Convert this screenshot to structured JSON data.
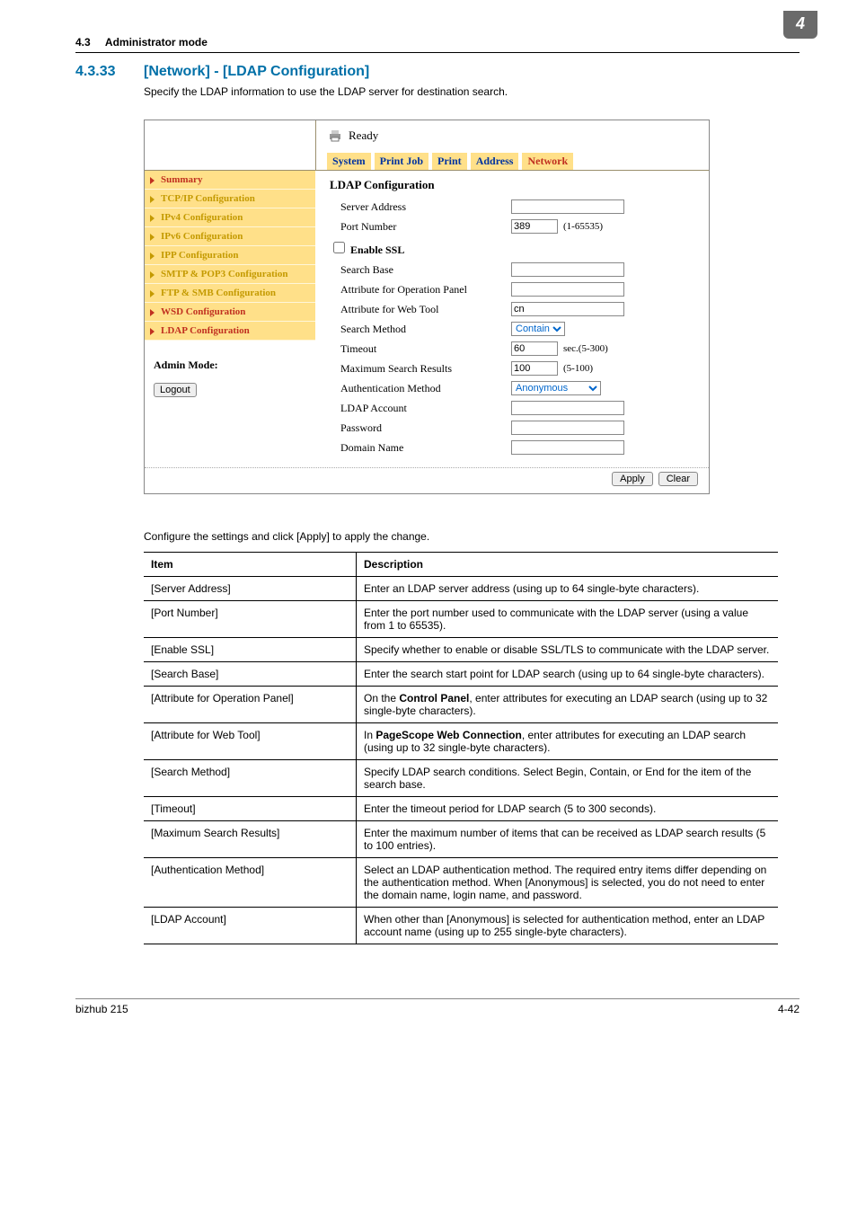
{
  "header": {
    "section_ref": "4.3",
    "section_ref_title": "Administrator mode",
    "badge": "4"
  },
  "section": {
    "num": "4.3.33",
    "title": "[Network] - [LDAP Configuration]"
  },
  "intro": "Specify the LDAP information to use the LDAP server for destination search.",
  "screenshot": {
    "ready": "Ready",
    "tabs": {
      "system": "System",
      "printjob": "Print Job",
      "print": "Print",
      "address": "Address",
      "network": "Network"
    },
    "side": {
      "summary": "Summary",
      "tcpip": "TCP/IP Configuration",
      "ipv4": "IPv4 Configuration",
      "ipv6": "IPv6 Configuration",
      "ipp": "IPP Configuration",
      "smtp": "SMTP & POP3 Configuration",
      "ftp": "FTP & SMB Configuration",
      "wsd": "WSD Configuration",
      "ldap": "LDAP Configuration"
    },
    "admin_mode": "Admin Mode:",
    "logout": "Logout",
    "form": {
      "title": "LDAP Configuration",
      "server_address": "Server Address",
      "port_number": "Port Number",
      "port_value": "389",
      "port_hint": "(1-65535)",
      "enable_ssl": "Enable SSL",
      "search_base": "Search Base",
      "attr_panel": "Attribute for Operation Panel",
      "attr_web": "Attribute for Web Tool",
      "attr_web_value": "cn",
      "search_method": "Search Method",
      "search_method_value": "Contain",
      "timeout": "Timeout",
      "timeout_value": "60",
      "timeout_hint": "sec.(5-300)",
      "max_results": "Maximum Search Results",
      "max_results_value": "100",
      "max_results_hint": "(5-100)",
      "auth_method": "Authentication Method",
      "auth_method_value": "Anonymous",
      "ldap_account": "LDAP Account",
      "password": "Password",
      "domain": "Domain Name",
      "apply": "Apply",
      "clear": "Clear"
    }
  },
  "config_text": "Configure the settings and click [Apply] to apply the change.",
  "table": {
    "head_item": "Item",
    "head_desc": "Description",
    "rows": [
      {
        "item": "[Server Address]",
        "desc": "Enter an LDAP server address (using up to 64 single-byte characters)."
      },
      {
        "item": "[Port Number]",
        "desc": "Enter the port number used to communicate with the LDAP server (using a value from 1 to 65535)."
      },
      {
        "item": "[Enable SSL]",
        "desc": "Specify whether to enable or disable SSL/TLS to communicate with the LDAP server."
      },
      {
        "item": "[Search Base]",
        "desc": "Enter the search start point for LDAP search (using up to 64 single-byte characters)."
      },
      {
        "item": "[Attribute for Operation Panel]",
        "desc_pre": "On the ",
        "desc_b": "Control Panel",
        "desc_post": ", enter attributes for executing an LDAP search (using up to 32 single-byte characters)."
      },
      {
        "item": "[Attribute for Web Tool]",
        "desc_pre": "In ",
        "desc_b": "PageScope Web Connection",
        "desc_post": ", enter attributes for executing an LDAP search (using up to 32 single-byte characters)."
      },
      {
        "item": "[Search Method]",
        "desc": "Specify LDAP search conditions. Select Begin, Contain, or End for the item of the search base."
      },
      {
        "item": "[Timeout]",
        "desc": "Enter the timeout period for LDAP search (5 to 300 seconds)."
      },
      {
        "item": "[Maximum Search Results]",
        "desc": "Enter the maximum number of items that can be received as LDAP search results (5 to 100 entries)."
      },
      {
        "item": "[Authentication Method]",
        "desc": "Select an LDAP authentication method. The required entry items differ depending on the authentication method. When [Anonymous] is selected, you do not need to enter the domain name, login name, and password."
      },
      {
        "item": "[LDAP Account]",
        "desc": "When other than [Anonymous] is selected for authentication method, enter an LDAP account name (using up to 255 single-byte characters)."
      }
    ]
  },
  "footer": {
    "left": "bizhub 215",
    "right": "4-42"
  }
}
